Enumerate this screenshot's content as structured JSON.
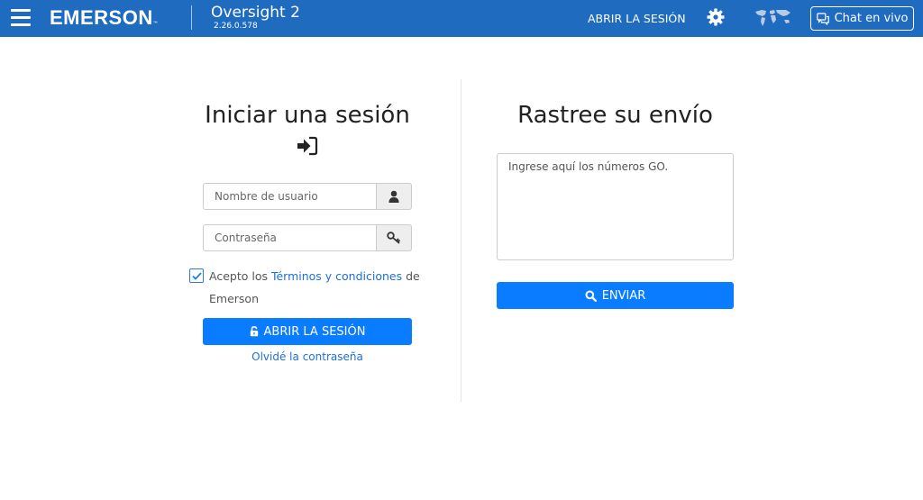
{
  "header": {
    "brand": "EMERSON",
    "brand_tm": "™",
    "app_name": "Oversight 2",
    "app_version": "2.26.0.578",
    "login_link": "ABRIR LA SESIÓN",
    "chat_label": "Chat en vivo"
  },
  "login": {
    "title": "Iniciar una sesión",
    "username_placeholder": "Nombre de usuario",
    "password_placeholder": "Contraseña",
    "terms_prefix": "Acepto los ",
    "terms_link": "Términos y condiciones",
    "terms_suffix": " de Emerson",
    "terms_checked": true,
    "submit_label": "ABRIR LA SESIÓN",
    "forgot_label": "Olvidé la contraseña"
  },
  "track": {
    "title": "Rastree su envío",
    "placeholder": "Ingrese aquí los números GO.",
    "submit_label": "ENVIAR"
  },
  "colors": {
    "header_bg": "#1f6bc0",
    "primary_button": "#0a7cff",
    "link": "#1e6fd9"
  },
  "icons": [
    "menu-icon",
    "gear-icon",
    "globe-map-icon",
    "chat-icon",
    "sign-in-icon",
    "user-icon",
    "key-icon",
    "checkmark-icon",
    "unlock-icon",
    "search-icon"
  ]
}
